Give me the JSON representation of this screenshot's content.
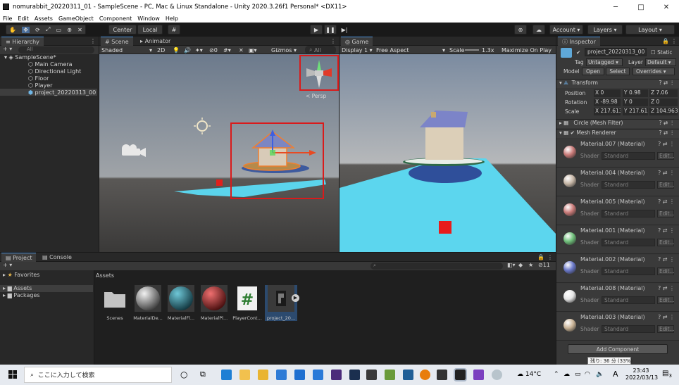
{
  "window": {
    "title": "nomurabbit_20220311_01 - SampleScene - PC, Mac & Linux Standalone - Unity 2020.3.26f1 Personal* <DX11>",
    "minimize": "─",
    "maximize": "□",
    "close": "✕"
  },
  "menu": [
    "File",
    "Edit",
    "Assets",
    "GameObject",
    "Component",
    "Window",
    "Help"
  ],
  "toolbar": {
    "pivot": "Center",
    "space": "Local",
    "account": "Account",
    "layers": "Layers",
    "layout": "Layout"
  },
  "hierarchy": {
    "tab": "Hierarchy",
    "search_placeholder": "All",
    "scene": "SampleScene*",
    "items": [
      "Main Camera",
      "Directional Light",
      "Floor",
      "Player",
      "project_20220313_00"
    ]
  },
  "scene": {
    "tabs": [
      "Scene",
      "Animator"
    ],
    "shading": "Shaded",
    "mode": "2D",
    "gizmos": "Gizmos",
    "search": "All",
    "persp": "< Persp",
    "counter": "0"
  },
  "game": {
    "tab": "Game",
    "display": "Display 1",
    "aspect": "Free Aspect",
    "scale_label": "Scale",
    "scale_value": "1.3x",
    "maximize": "Maximize On Play"
  },
  "inspector": {
    "tab": "Inspector",
    "object_name": "project_20220313_00",
    "static": "Static",
    "tag_label": "Tag",
    "tag": "Untagged",
    "layer_label": "Layer",
    "layer": "Default",
    "model_label": "Model",
    "open": "Open",
    "select": "Select",
    "overrides": "Overrides",
    "transform": {
      "title": "Transform",
      "position_label": "Position",
      "rotation_label": "Rotation",
      "scale_label": "Scale",
      "position": [
        "0",
        "0.98",
        "7.06"
      ],
      "rotation": [
        "-89.98",
        "0",
        "0"
      ],
      "scale": [
        "217.613",
        "217.613",
        "104.963"
      ]
    },
    "mesh_filter": "Circle (Mesh Filter)",
    "mesh_renderer": "Mesh Renderer",
    "materials": [
      {
        "name": "Material.007 (Material)",
        "color": "#c97a78"
      },
      {
        "name": "Material.004 (Material)",
        "color": "#c6b6a6"
      },
      {
        "name": "Material.005 (Material)",
        "color": "#c97a78"
      },
      {
        "name": "Material.001 (Material)",
        "color": "#6fbf7a"
      },
      {
        "name": "Material.002 (Material)",
        "color": "#6a78c9"
      },
      {
        "name": "Material.008 (Material)",
        "color": "#e6e6e6"
      },
      {
        "name": "Material.003 (Material)",
        "color": "#c9b396"
      }
    ],
    "shader_label": "Shader",
    "shader_value": "Standard",
    "edit": "Edit...",
    "add_component": "Add Component",
    "tooltip": "残り: 36 分 (33%)"
  },
  "project": {
    "tabs": [
      "Project",
      "Console"
    ],
    "favorites": "Favorites",
    "assets_root": "Assets",
    "packages": "Packages",
    "breadcrumb": "Assets",
    "count": "11",
    "assets": [
      "Scenes",
      "MaterialDe...",
      "MaterialFl...",
      "MaterialPl...",
      "PlayerCont...",
      "project_20..."
    ]
  },
  "taskbar": {
    "search": "ここに入力して検索",
    "weather": "14°C",
    "ime": "A",
    "time": "23:43",
    "date": "2022/03/13",
    "notif": "3"
  }
}
